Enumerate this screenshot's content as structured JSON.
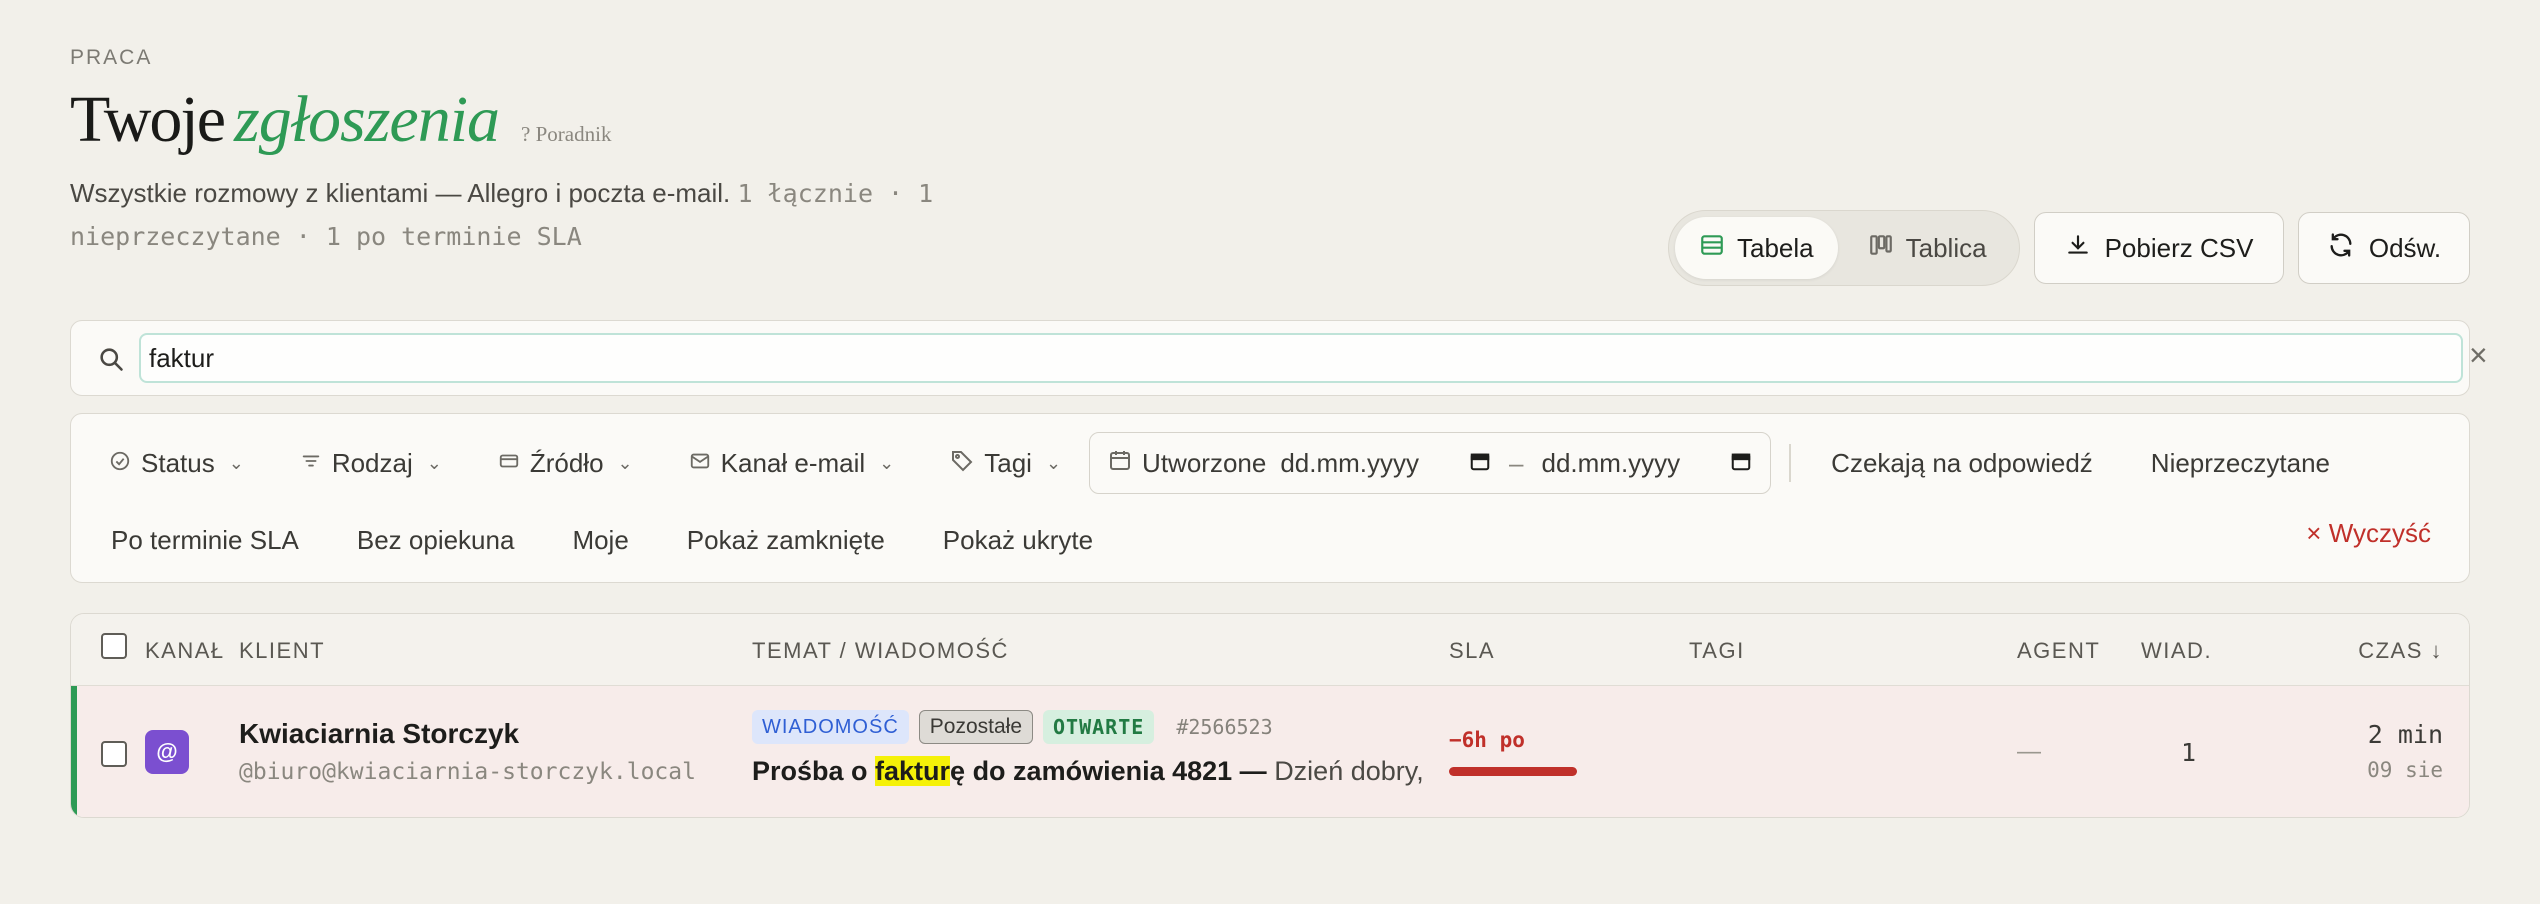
{
  "header": {
    "eyebrow": "PRACA",
    "title_part1": "Twoje",
    "title_part2": "zgłoszenia",
    "guide_link": "? Poradnik",
    "subtitle": "Wszystkie rozmowy z klientami — Allegro i poczta e-mail.",
    "stats": "1 łącznie · 1 nieprzeczytane · 1 po terminie SLA"
  },
  "view_switch": {
    "table_label": "Tabela",
    "board_label": "Tablica",
    "active": "Tabela"
  },
  "toolbar": {
    "csv_label": "Pobierz CSV",
    "refresh_label": "Odśw."
  },
  "search": {
    "value": "faktur",
    "clear_label": "×"
  },
  "filters": {
    "status": "Status",
    "kind": "Rodzaj",
    "source": "Źródło",
    "email_channel": "Kanał e-mail",
    "tags": "Tagi",
    "created_label": "Utworzone",
    "date_from": "dd.mm.yyyy",
    "date_sep": "–",
    "date_to": "dd.mm.yyyy",
    "awaiting_reply": "Czekają na odpowiedź",
    "unread": "Nieprzeczytane",
    "sla_overdue": "Po terminie SLA",
    "unassigned": "Bez opiekuna",
    "mine": "Moje",
    "show_closed": "Pokaż zamknięte",
    "show_hidden": "Pokaż ukryte",
    "clear_all": "× Wyczyść"
  },
  "table": {
    "columns": {
      "channel": "KANAŁ",
      "client": "KLIENT",
      "subject": "TEMAT / WIADOMOŚĆ",
      "sla": "SLA",
      "tags": "TAGI",
      "agent": "AGENT",
      "messages": "WIAD.",
      "time": "CZAS ↓"
    },
    "rows": [
      {
        "channel_icon": "@",
        "client_name": "Kwiaciarnia Storczyk",
        "client_email": "@biuro@kwiaciarnia-storczyk.local",
        "badge_type": "WIADOMOŚĆ",
        "badge_category": "Pozostałe",
        "badge_status": "OTWARTE",
        "ticket_id": "#2566523",
        "subject_before": "Prośba o ",
        "subject_match": "faktur",
        "subject_after": "ę do zamówienia 4821 —",
        "preview": "Dzień dobry, ...",
        "sla_text": "−6h po",
        "sla_overdue_fraction": 1.0,
        "agent": "—",
        "message_count": "1",
        "time": "2 min",
        "date": "09 sie"
      }
    ]
  },
  "colors": {
    "accent_green": "#2e9a55",
    "danger_red": "#c0302a",
    "channel_email": "#7b4fd0",
    "highlight": "#f5f108"
  }
}
